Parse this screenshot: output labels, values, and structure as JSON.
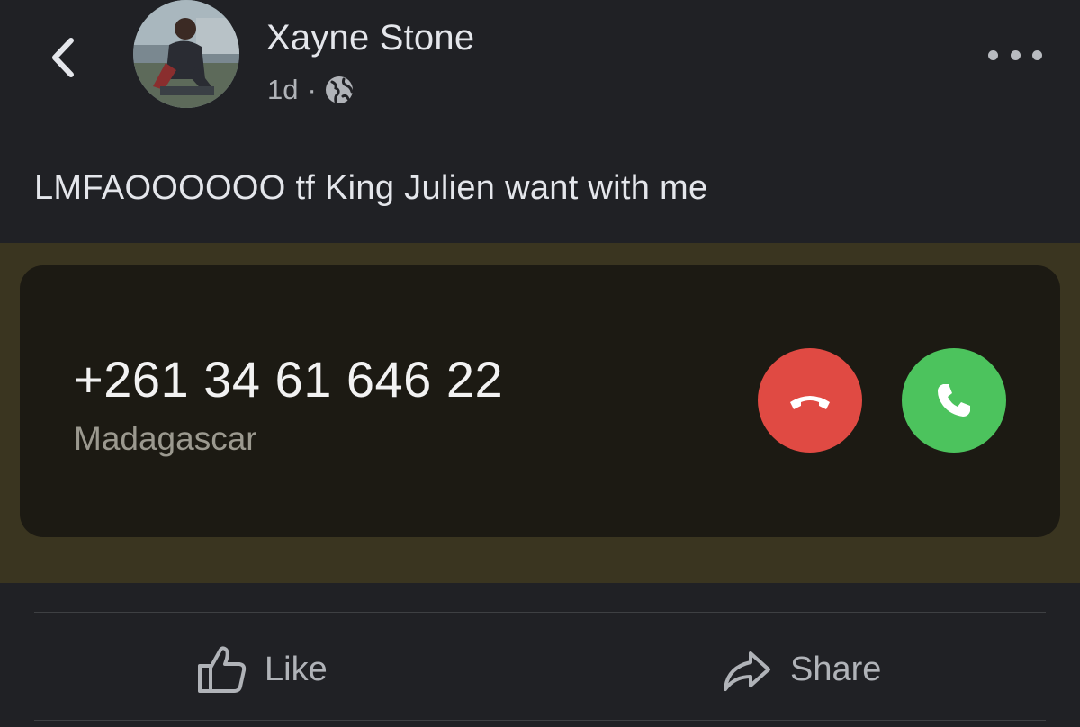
{
  "header": {
    "author_name": "Xayne Stone",
    "timestamp": "1d",
    "separator": "·",
    "privacy_icon": "globe-icon",
    "back_icon": "chevron-left-icon",
    "more_icon": "more-horizontal-icon"
  },
  "post": {
    "text": "LMFAOOOOOO tf King Julien want with me"
  },
  "call": {
    "number": "+261 34 61 646 22",
    "location": "Madagascar",
    "decline_icon": "phone-hangup-icon",
    "accept_icon": "phone-icon",
    "colors": {
      "decline": "#e04a43",
      "accept": "#4cc35d"
    }
  },
  "actions": {
    "like_label": "Like",
    "share_label": "Share",
    "like_icon": "thumbs-up-icon",
    "share_icon": "share-arrow-icon"
  }
}
